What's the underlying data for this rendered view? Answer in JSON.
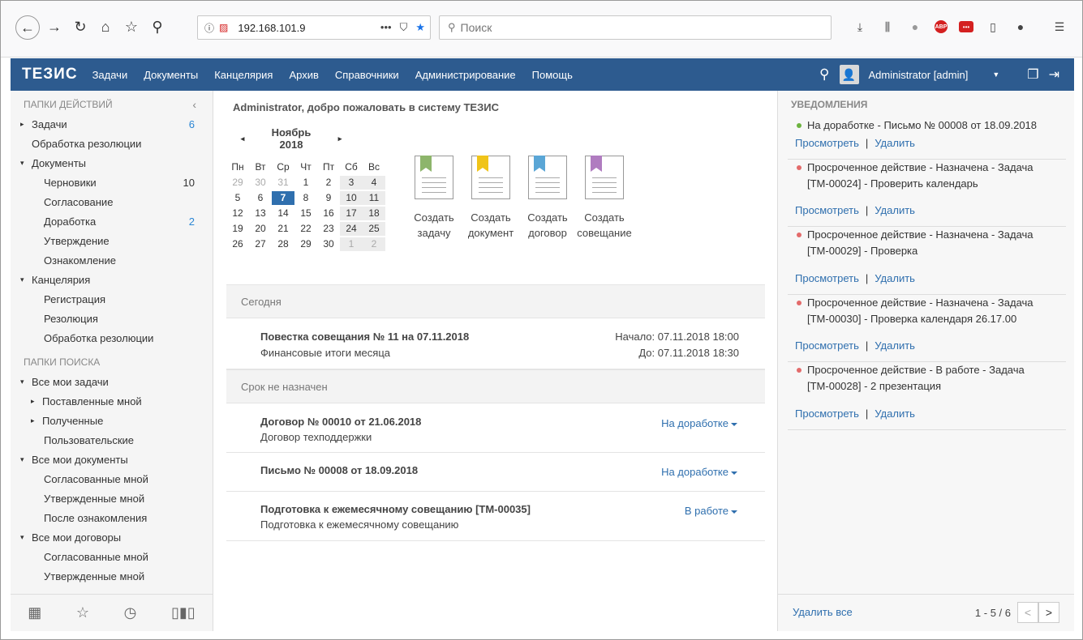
{
  "browser": {
    "url": "192.168.101.9",
    "search_placeholder": "Поиск"
  },
  "app": {
    "logo": "ТЕЗИС",
    "menu": [
      "Задачи",
      "Документы",
      "Канцелярия",
      "Архив",
      "Справочники",
      "Администрирование",
      "Помощь"
    ],
    "user": "Administrator [admin]"
  },
  "sidebar": {
    "action_title": "ПАПКИ ДЕЙСТВИЙ",
    "search_title": "ПАПКИ ПОИСКА",
    "action_items": [
      {
        "label": "Задачи",
        "count": "6",
        "level": 0,
        "arrow": "▸",
        "blue": true
      },
      {
        "label": "Обработка резолюции",
        "count": "",
        "level": 0,
        "arrow": "",
        "blue": false
      },
      {
        "label": "Документы",
        "count": "",
        "level": 0,
        "arrow": "▾",
        "blue": false
      },
      {
        "label": "Черновики",
        "count": "10",
        "level": 1,
        "arrow": "",
        "blue": false
      },
      {
        "label": "Согласование",
        "count": "",
        "level": 1,
        "arrow": "",
        "blue": false
      },
      {
        "label": "Доработка",
        "count": "2",
        "level": 1,
        "arrow": "",
        "blue": true
      },
      {
        "label": "Утверждение",
        "count": "",
        "level": 1,
        "arrow": "",
        "blue": false
      },
      {
        "label": "Ознакомление",
        "count": "",
        "level": 1,
        "arrow": "",
        "blue": false
      },
      {
        "label": "Канцелярия",
        "count": "",
        "level": 0,
        "arrow": "▾",
        "blue": false
      },
      {
        "label": "Регистрация",
        "count": "",
        "level": 1,
        "arrow": "",
        "blue": false
      },
      {
        "label": "Резолюция",
        "count": "",
        "level": 1,
        "arrow": "",
        "blue": false
      },
      {
        "label": "Обработка резолюции",
        "count": "",
        "level": 1,
        "arrow": "",
        "blue": false
      }
    ],
    "search_items": [
      {
        "label": "Все мои задачи",
        "level": 0,
        "arrow": "▾"
      },
      {
        "label": "Поставленные мной",
        "level": 1,
        "arrow": "▸"
      },
      {
        "label": "Полученные",
        "level": 1,
        "arrow": "▸"
      },
      {
        "label": "Пользовательские",
        "level": 1,
        "arrow": ""
      },
      {
        "label": "Все мои документы",
        "level": 0,
        "arrow": "▾"
      },
      {
        "label": "Согласованные мной",
        "level": 1,
        "arrow": ""
      },
      {
        "label": "Утвержденные мной",
        "level": 1,
        "arrow": ""
      },
      {
        "label": "После ознакомления",
        "level": 1,
        "arrow": ""
      },
      {
        "label": "Все мои договоры",
        "level": 0,
        "arrow": "▾"
      },
      {
        "label": "Согласованные мной",
        "level": 1,
        "arrow": ""
      },
      {
        "label": "Утвержденные мной",
        "level": 1,
        "arrow": ""
      }
    ]
  },
  "main": {
    "welcome": "Administrator, добро пожаловать в систему ТЕЗИС",
    "calendar": {
      "month": "Ноябрь 2018",
      "dow": [
        "Пн",
        "Вт",
        "Ср",
        "Чт",
        "Пт",
        "Сб",
        "Вс"
      ],
      "days": [
        "29",
        "30",
        "31",
        "1",
        "2",
        "3",
        "4",
        "5",
        "6",
        "7",
        "8",
        "9",
        "10",
        "11",
        "12",
        "13",
        "14",
        "15",
        "16",
        "17",
        "18",
        "19",
        "20",
        "21",
        "22",
        "23",
        "24",
        "25",
        "26",
        "27",
        "28",
        "29",
        "30",
        "1",
        "2"
      ],
      "selected": "7"
    },
    "tiles": [
      {
        "line1": "Создать",
        "line2": "задачу",
        "color": "#8db56b"
      },
      {
        "line1": "Создать",
        "line2": "документ",
        "color": "#f0c419"
      },
      {
        "line1": "Создать",
        "line2": "договор",
        "color": "#5aa6d6"
      },
      {
        "line1": "Создать",
        "line2": "совещание",
        "color": "#b07cc0"
      }
    ],
    "today_label": "Сегодня",
    "nodeadline_label": "Срок не назначен",
    "meeting": {
      "title": "Повестка совещания № 11 на 07.11.2018",
      "subtitle": "Финансовые итоги месяца",
      "start": "Начало: 07.11.2018 18:00",
      "end": "До: 07.11.2018 18:30"
    },
    "tasks": [
      {
        "title": "Договор № 00010 от 21.06.2018",
        "subtitle": "Договор техподдержки",
        "status": "На доработке"
      },
      {
        "title": "Письмо № 00008 от 18.09.2018",
        "subtitle": "",
        "status": "На доработке"
      },
      {
        "title": "Подготовка к ежемесячному совещанию [ТМ-00035]",
        "subtitle": "Подготовка к ежемесячному совещанию",
        "status": "В работе"
      }
    ]
  },
  "notifications": {
    "title": "УВЕДОМЛЕНИЯ",
    "view_label": "Просмотреть",
    "delete_label": "Удалить",
    "items": [
      {
        "text": "На доработке - Письмо № 00008 от 18.09.2018",
        "dot_color": "#6cb33f"
      },
      {
        "text": "Просроченное действие - Назначена - Задача [ТМ-00024] - Проверить календарь",
        "dot_color": "#e36b6b"
      },
      {
        "text": "Просроченное действие - Назначена - Задача [ТМ-00029] - Проверка",
        "dot_color": "#e36b6b"
      },
      {
        "text": "Просроченное действие - Назначена - Задача [ТМ-00030] - Проверка календаря 26.17.00",
        "dot_color": "#e36b6b"
      },
      {
        "text": "Просроченное действие - В работе - Задача [ТМ-00028] - 2 презентация",
        "dot_color": "#e36b6b"
      }
    ],
    "delete_all": "Удалить все",
    "pagination": "1 - 5 / 6",
    "prev": "<",
    "next": ">"
  }
}
